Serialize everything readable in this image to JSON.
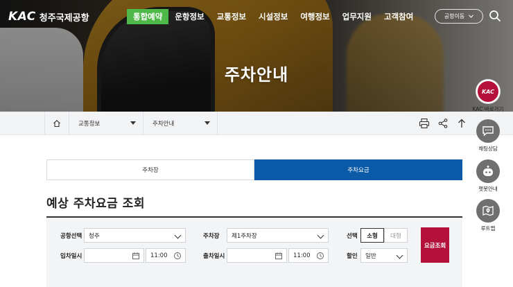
{
  "header": {
    "logo_mark": "KAC",
    "logo_text": "청주국제공항",
    "nav": [
      "통합예약",
      "운항정보",
      "교통정보",
      "시설정보",
      "여행정보",
      "업무지원",
      "고객참여"
    ],
    "airport_select": "공항이동"
  },
  "hero": {
    "title": "주차안내"
  },
  "breadcrumb": {
    "level1": "교통정보",
    "level2": "주차안내"
  },
  "tabs": [
    "주차장",
    "주차요금"
  ],
  "section_title": "예상 주차요금 조회",
  "form": {
    "airport_label": "공항선택",
    "airport_value": "청주",
    "lot_label": "주차장",
    "lot_value": "제1주차장",
    "car_label": "선택",
    "car_small": "소형",
    "car_large": "대형",
    "entry_label": "입차일시",
    "entry_time": "11:00",
    "exit_label": "출차일시",
    "exit_time": "11:00",
    "discount_label": "할인",
    "discount_value": "일반",
    "submit_label": "요금조회"
  },
  "quick_menu": {
    "kac_logo": "KAC",
    "kac_label": "KAC 바로가기",
    "chat_label": "채팅상담",
    "chatbot_label": "챗봇안내",
    "route_label": "루트맵"
  },
  "colors": {
    "nav_active": "#4eb848",
    "tab_active": "#0b5aa7",
    "submit": "#b3103c"
  }
}
